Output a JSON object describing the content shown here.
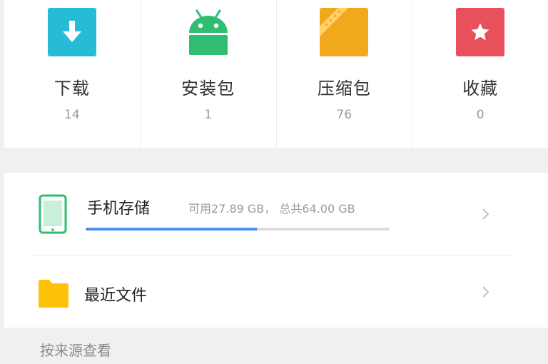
{
  "categories": [
    {
      "label": "下载",
      "count": "14",
      "icon": "download-icon",
      "color": "#26bcd7"
    },
    {
      "label": "安装包",
      "count": "1",
      "icon": "android-icon",
      "color": "#2ebd71"
    },
    {
      "label": "压缩包",
      "count": "76",
      "icon": "archive-icon",
      "color": "#f2a81d"
    },
    {
      "label": "收藏",
      "count": "0",
      "icon": "star-icon",
      "color": "#e8505b"
    }
  ],
  "storage": {
    "title": "手机存储",
    "info": "可用27.89 GB， 总共64.00 GB",
    "used_fraction": 0.564,
    "icon": "phone-icon",
    "accent": "#4a90e2",
    "icon_color": "#2ebd71"
  },
  "recent": {
    "title": "最近文件",
    "icon": "folder-icon",
    "icon_color": "#ffc107"
  },
  "section": {
    "title": "按来源查看"
  }
}
